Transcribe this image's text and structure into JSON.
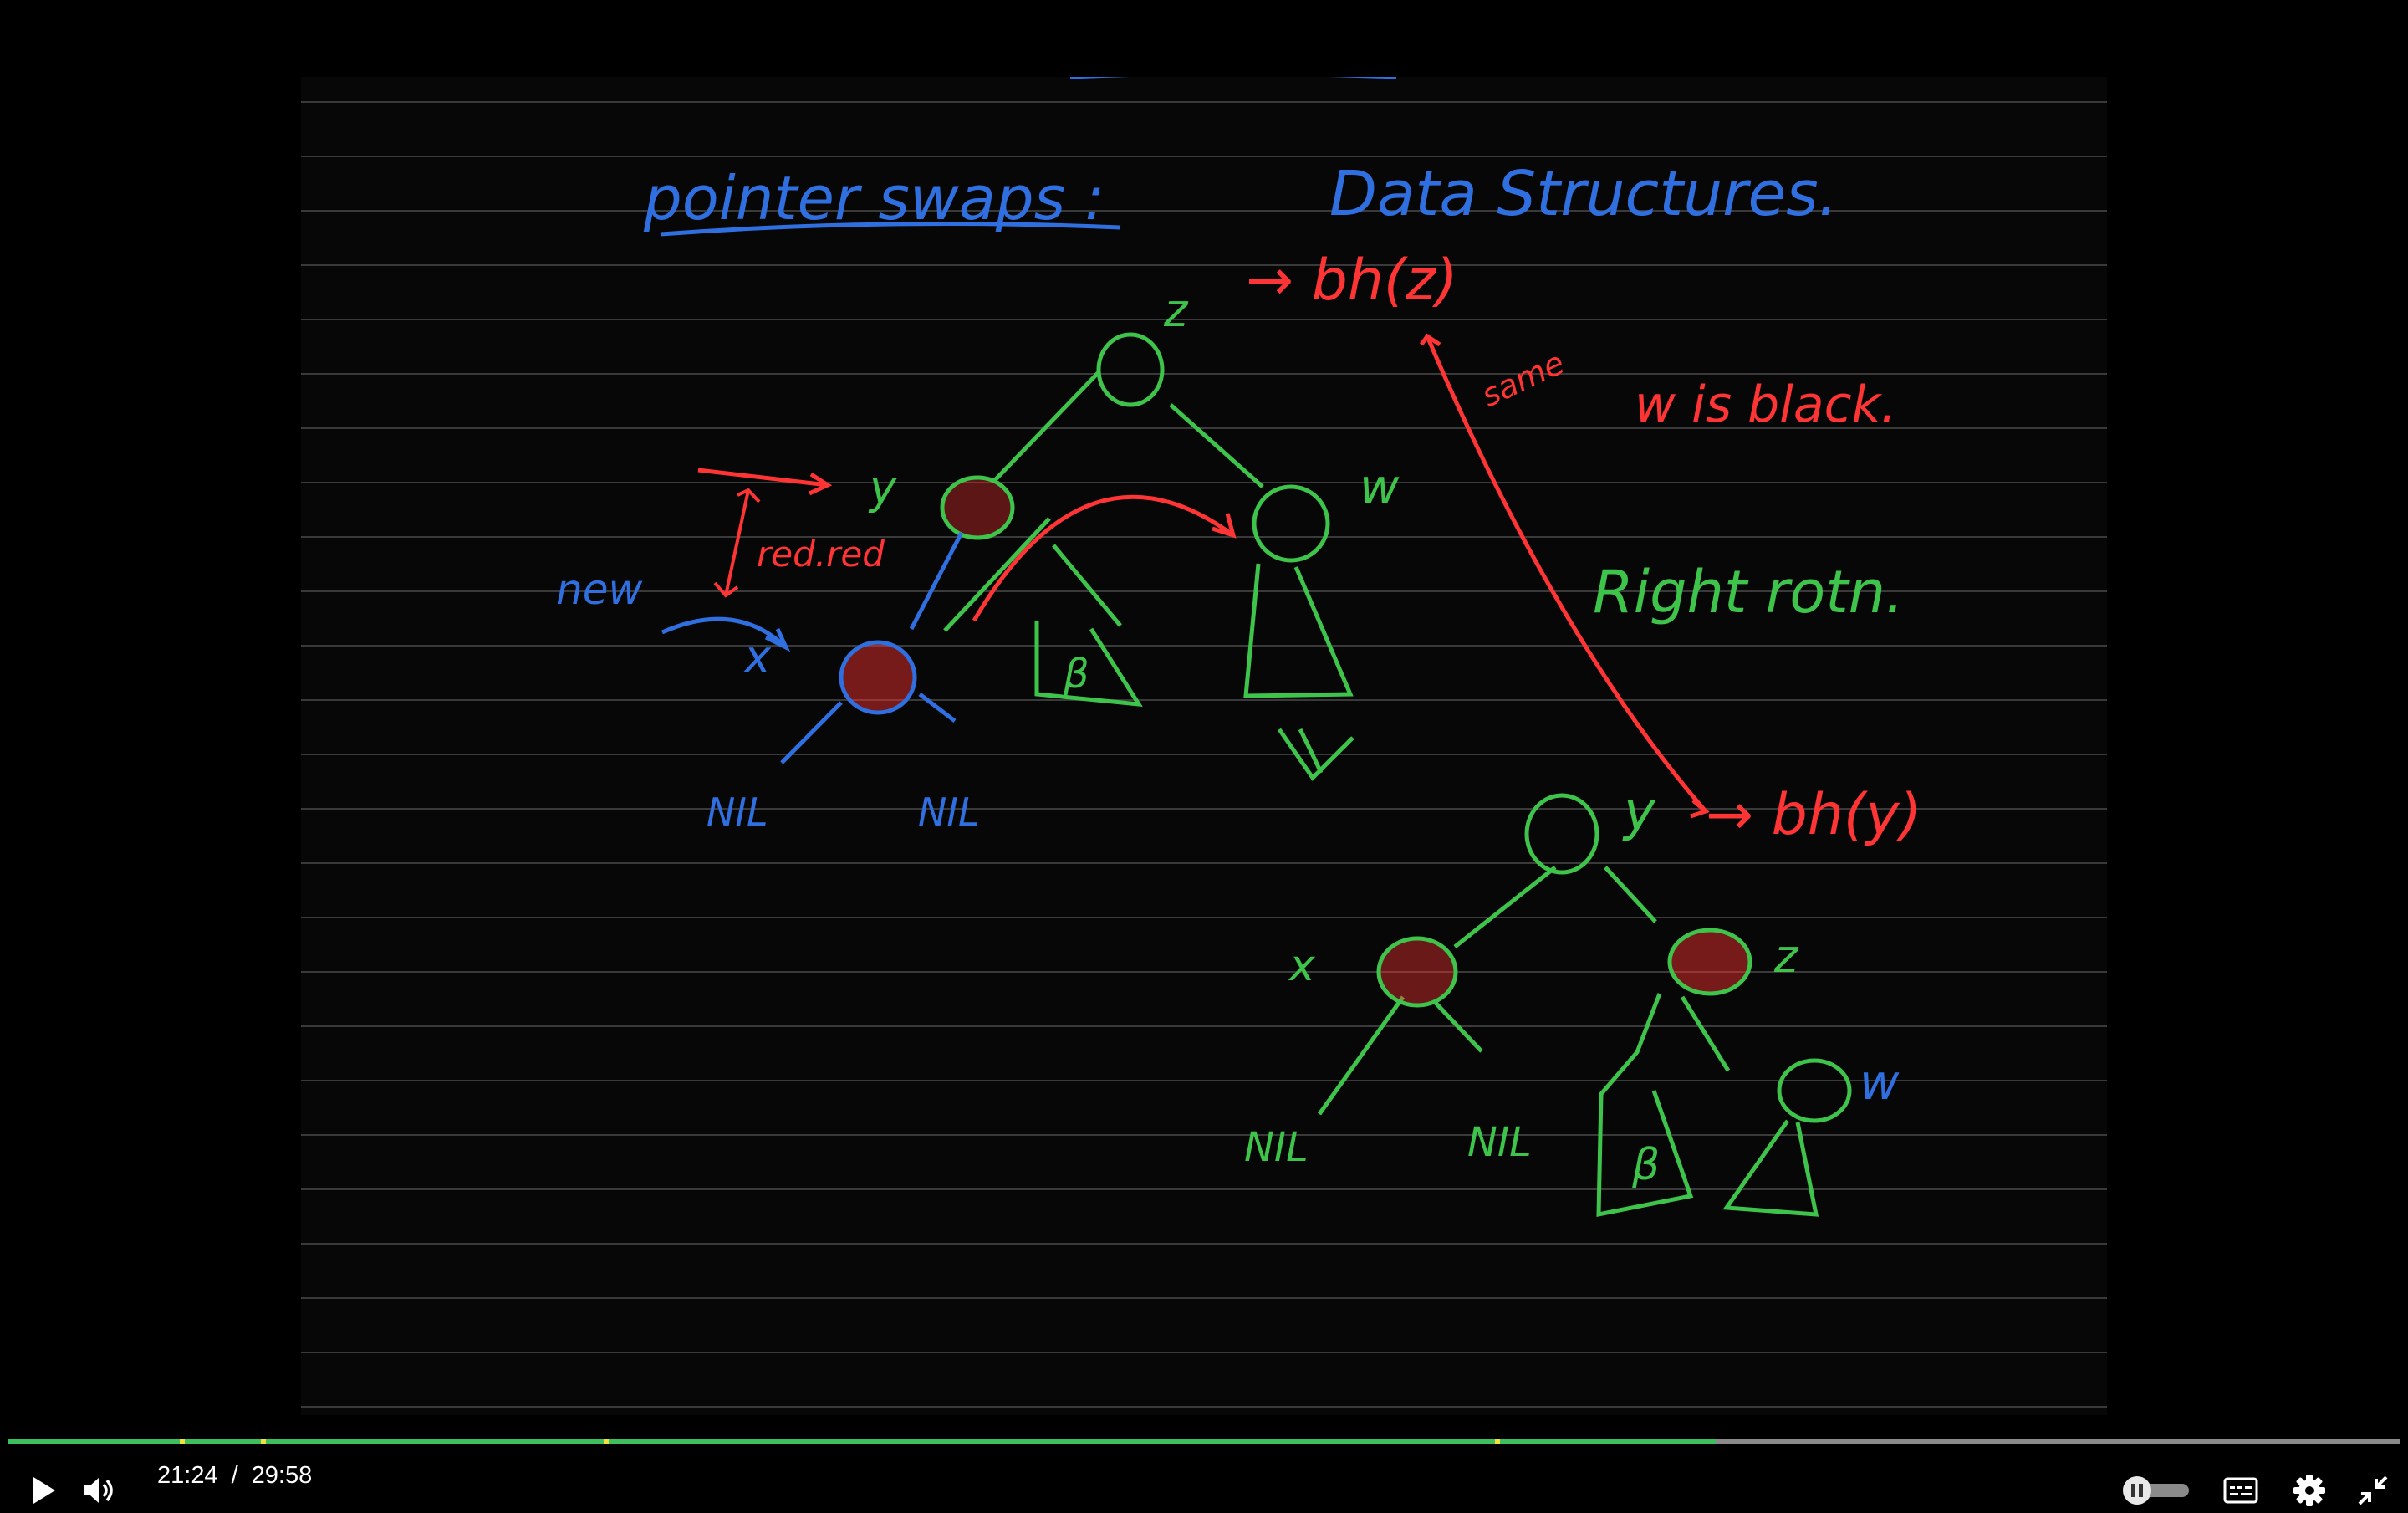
{
  "notes": {
    "heading_left": "pointer swaps :",
    "heading_right": "Data Structures.",
    "annotations": {
      "bh_z": "→ bh(z)",
      "same": "same",
      "w_is_black": "w is black.",
      "red_red": "red.red",
      "new": "new",
      "right_rotn": "Right rotn.",
      "bh_y": "→ bh(y)"
    },
    "tree_before": {
      "root": "z",
      "left": "y",
      "right": "w",
      "new_node": "x",
      "leaf_left": "NIL",
      "leaf_right": "NIL",
      "subtree": "β"
    },
    "tree_after": {
      "root": "y",
      "left": "x",
      "right": "z",
      "right_right": "w",
      "leaf_left": "NIL",
      "leaf_right": "NIL",
      "subtree": "β"
    },
    "colors": {
      "blue": "#2f6fe0",
      "green": "#3ec44a",
      "red": "#ff3434"
    }
  },
  "player": {
    "current_time": "21:24",
    "separator": "/",
    "duration": "29:58",
    "progress_fraction": 0.714,
    "play_icon": "play-icon",
    "volume_icon": "volume-icon",
    "cc_icon": "captions-icon",
    "settings_icon": "gear-icon",
    "fullscreen_icon": "exit-fullscreen-icon",
    "colors": {
      "played": "#3cbf5c",
      "track": "#8a8a8a",
      "chapter": "#f0e23a"
    }
  }
}
